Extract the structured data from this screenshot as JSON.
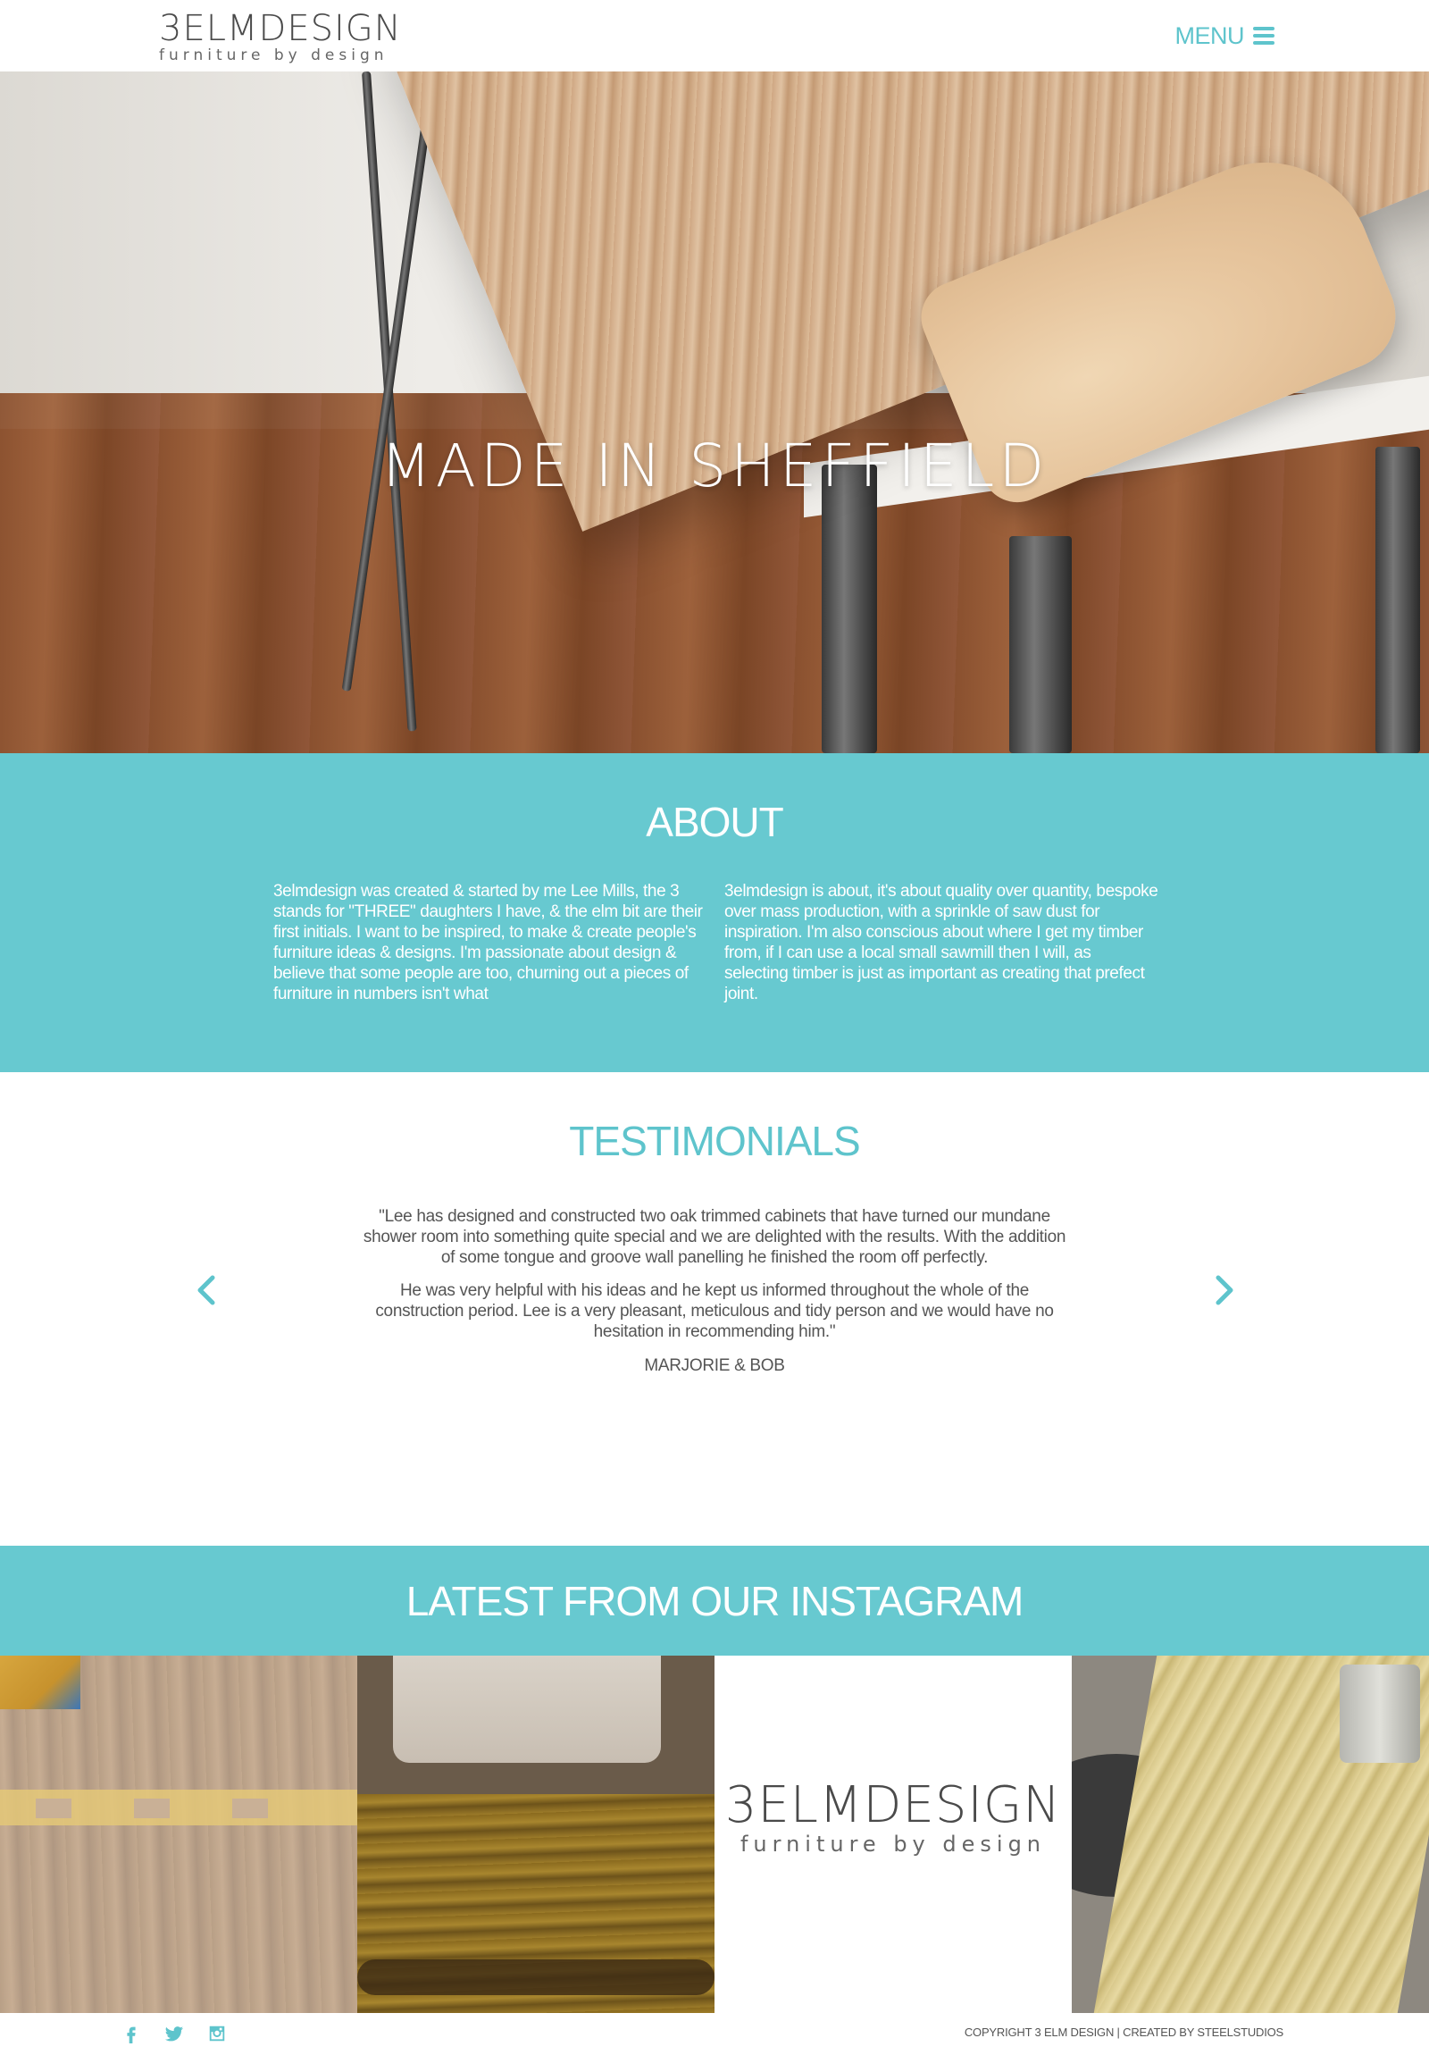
{
  "header": {
    "logo_main": "3ELMDESIGN",
    "logo_sub": "furniture by design",
    "menu_label": "MENU"
  },
  "hero": {
    "title": "MADE IN SHEFFIELD"
  },
  "about": {
    "heading": "ABOUT",
    "col_left": "3elmdesign was created & started by me Lee Mills, the 3 stands for \"THREE\" daughters I have, & the elm bit are their first initials. I want to be inspired, to make & create people's furniture ideas & designs. I'm passionate about design & believe that some people are too, churning out a pieces of furniture in numbers isn't what",
    "col_right": "3elmdesign is about, it's about quality over quantity, bespoke over mass production, with a sprinkle of saw dust for inspiration. I'm also conscious about where I get my timber from, if I can use a local small sawmill then I will, as selecting timber is just as important as creating that prefect joint."
  },
  "testimonials": {
    "heading": "TESTIMONIALS",
    "quote_p1": "\"Lee has designed and constructed two oak trimmed cabinets that have turned our mundane shower room into something quite special and we are delighted with the results. With the addition of some tongue and groove wall panelling he finished the room off perfectly.",
    "quote_p2": "He was very helpful with his ideas and he kept us informed throughout the whole of the construction period. Lee is a very pleasant, meticulous and tidy person and we would have no hesitation in recommending him.\"",
    "author": "MARJORIE & BOB"
  },
  "instagram": {
    "heading": "LATEST FROM OUR INSTAGRAM",
    "tile_logo_main": "3ELMDESIGN",
    "tile_logo_sub": "furniture by design"
  },
  "footer": {
    "social": [
      "facebook-icon",
      "twitter-icon",
      "instagram-icon"
    ],
    "copyright": "COPYRIGHT 3 ELM DESIGN | CREATED BY STEELSTUDIOS"
  },
  "colors": {
    "accent": "#67c9d0",
    "accent_text": "#5ec4cc",
    "text": "#555555"
  }
}
